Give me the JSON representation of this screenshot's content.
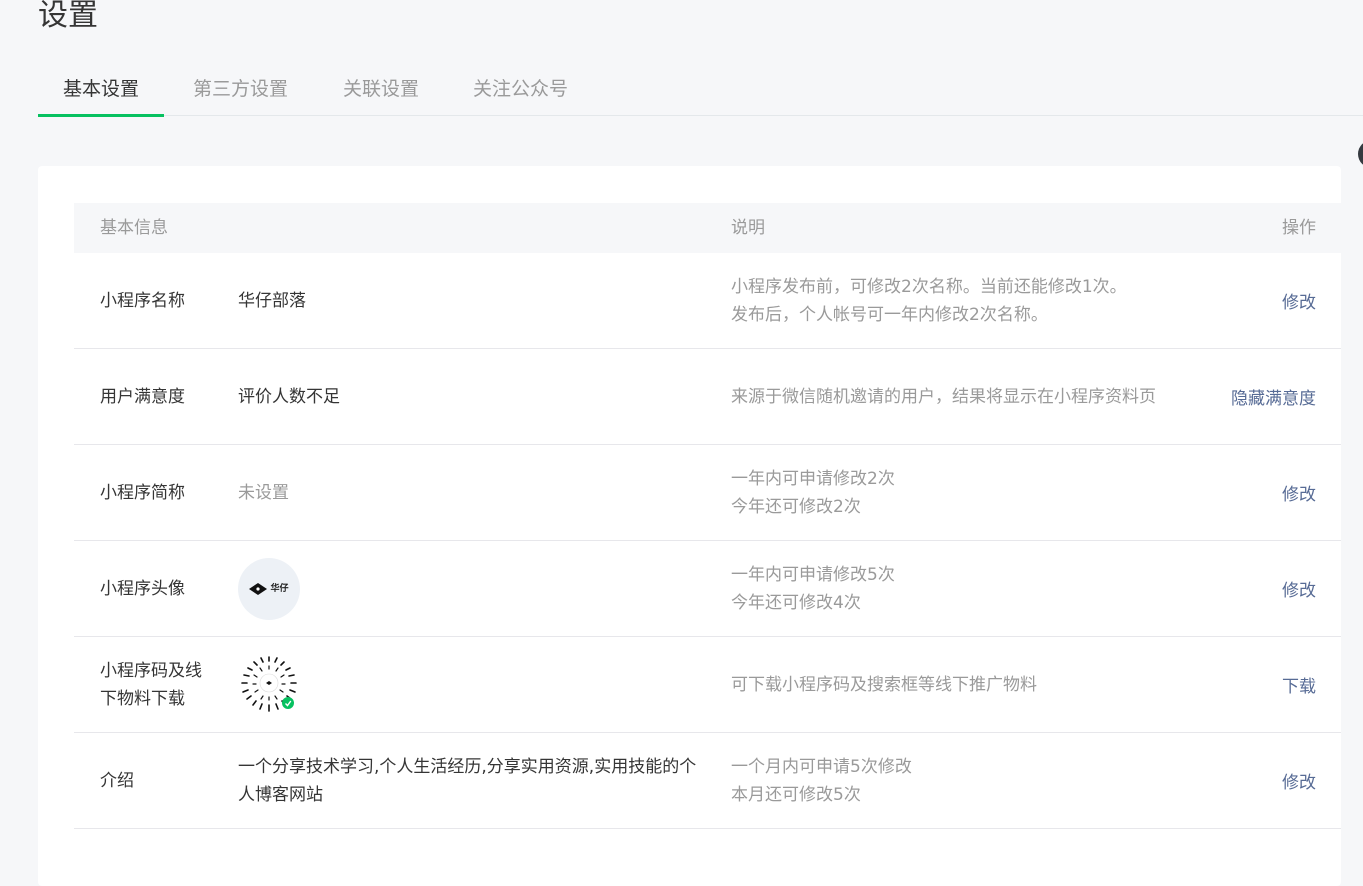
{
  "page": {
    "title": "设置"
  },
  "tabs": [
    {
      "label": "基本设置",
      "active": true
    },
    {
      "label": "第三方设置",
      "active": false
    },
    {
      "label": "关联设置",
      "active": false
    },
    {
      "label": "关注公众号",
      "active": false
    }
  ],
  "table": {
    "headers": {
      "info": "基本信息",
      "desc": "说明",
      "action": "操作"
    },
    "rows": [
      {
        "name": "小程序名称",
        "value": "华仔部落",
        "desc": [
          "小程序发布前，可修改2次名称。当前还能修改1次。",
          "发布后，个人帐号可一年内修改2次名称。"
        ],
        "action": "修改"
      },
      {
        "name": "用户满意度",
        "value": "评价人数不足",
        "desc": [
          "来源于微信随机邀请的用户，结果将显示在小程序资料页"
        ],
        "action": "隐藏满意度"
      },
      {
        "name": "小程序简称",
        "value": "未设置",
        "desc": [
          "一年内可申请修改2次",
          "今年还可修改2次"
        ],
        "action": "修改"
      },
      {
        "name": "小程序头像",
        "value_image": "avatar-icon",
        "avatar_text": "华仔",
        "desc": [
          "一年内可申请修改5次",
          "今年还可修改4次"
        ],
        "action": "修改"
      },
      {
        "name": "小程序码及线下物料下载",
        "value_image": "mini-program-code-icon",
        "desc": [
          "可下载小程序码及搜索框等线下推广物料"
        ],
        "action": "下载"
      },
      {
        "name": "介绍",
        "value": "一个分享技术学习,个人生活经历,分享实用资源,实用技能的个人博客网站",
        "desc": [
          "一个月内可申请5次修改",
          "本月还可修改5次"
        ],
        "action": "修改"
      }
    ]
  },
  "colors": {
    "accent": "#07c160",
    "link": "#576b95",
    "muted": "#9a9a9a",
    "text": "#353535"
  }
}
